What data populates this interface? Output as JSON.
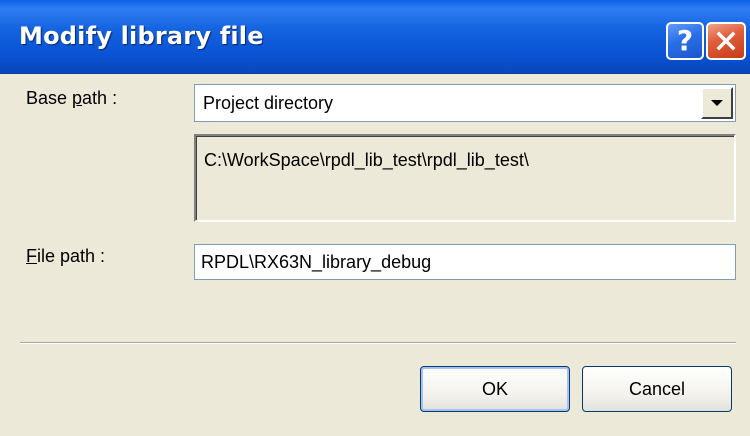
{
  "window": {
    "title": "Modify library file",
    "help_label": "?",
    "close_icon": "close-icon"
  },
  "base_path": {
    "label_prefix": "Base ",
    "label_accel": "p",
    "label_suffix": "ath :",
    "selected": "Project directory",
    "resolved": "C:\\WorkSpace\\rpdl_lib_test\\rpdl_lib_test\\"
  },
  "file_path": {
    "label_accel": "F",
    "label_suffix": "ile path :",
    "value": "RPDL\\RX63N_library_debug"
  },
  "buttons": {
    "ok": "OK",
    "cancel": "Cancel"
  },
  "colors": {
    "titlebar": "#0a53d4",
    "dialog_bg": "#ece9d8",
    "close_button": "#e1603c"
  }
}
